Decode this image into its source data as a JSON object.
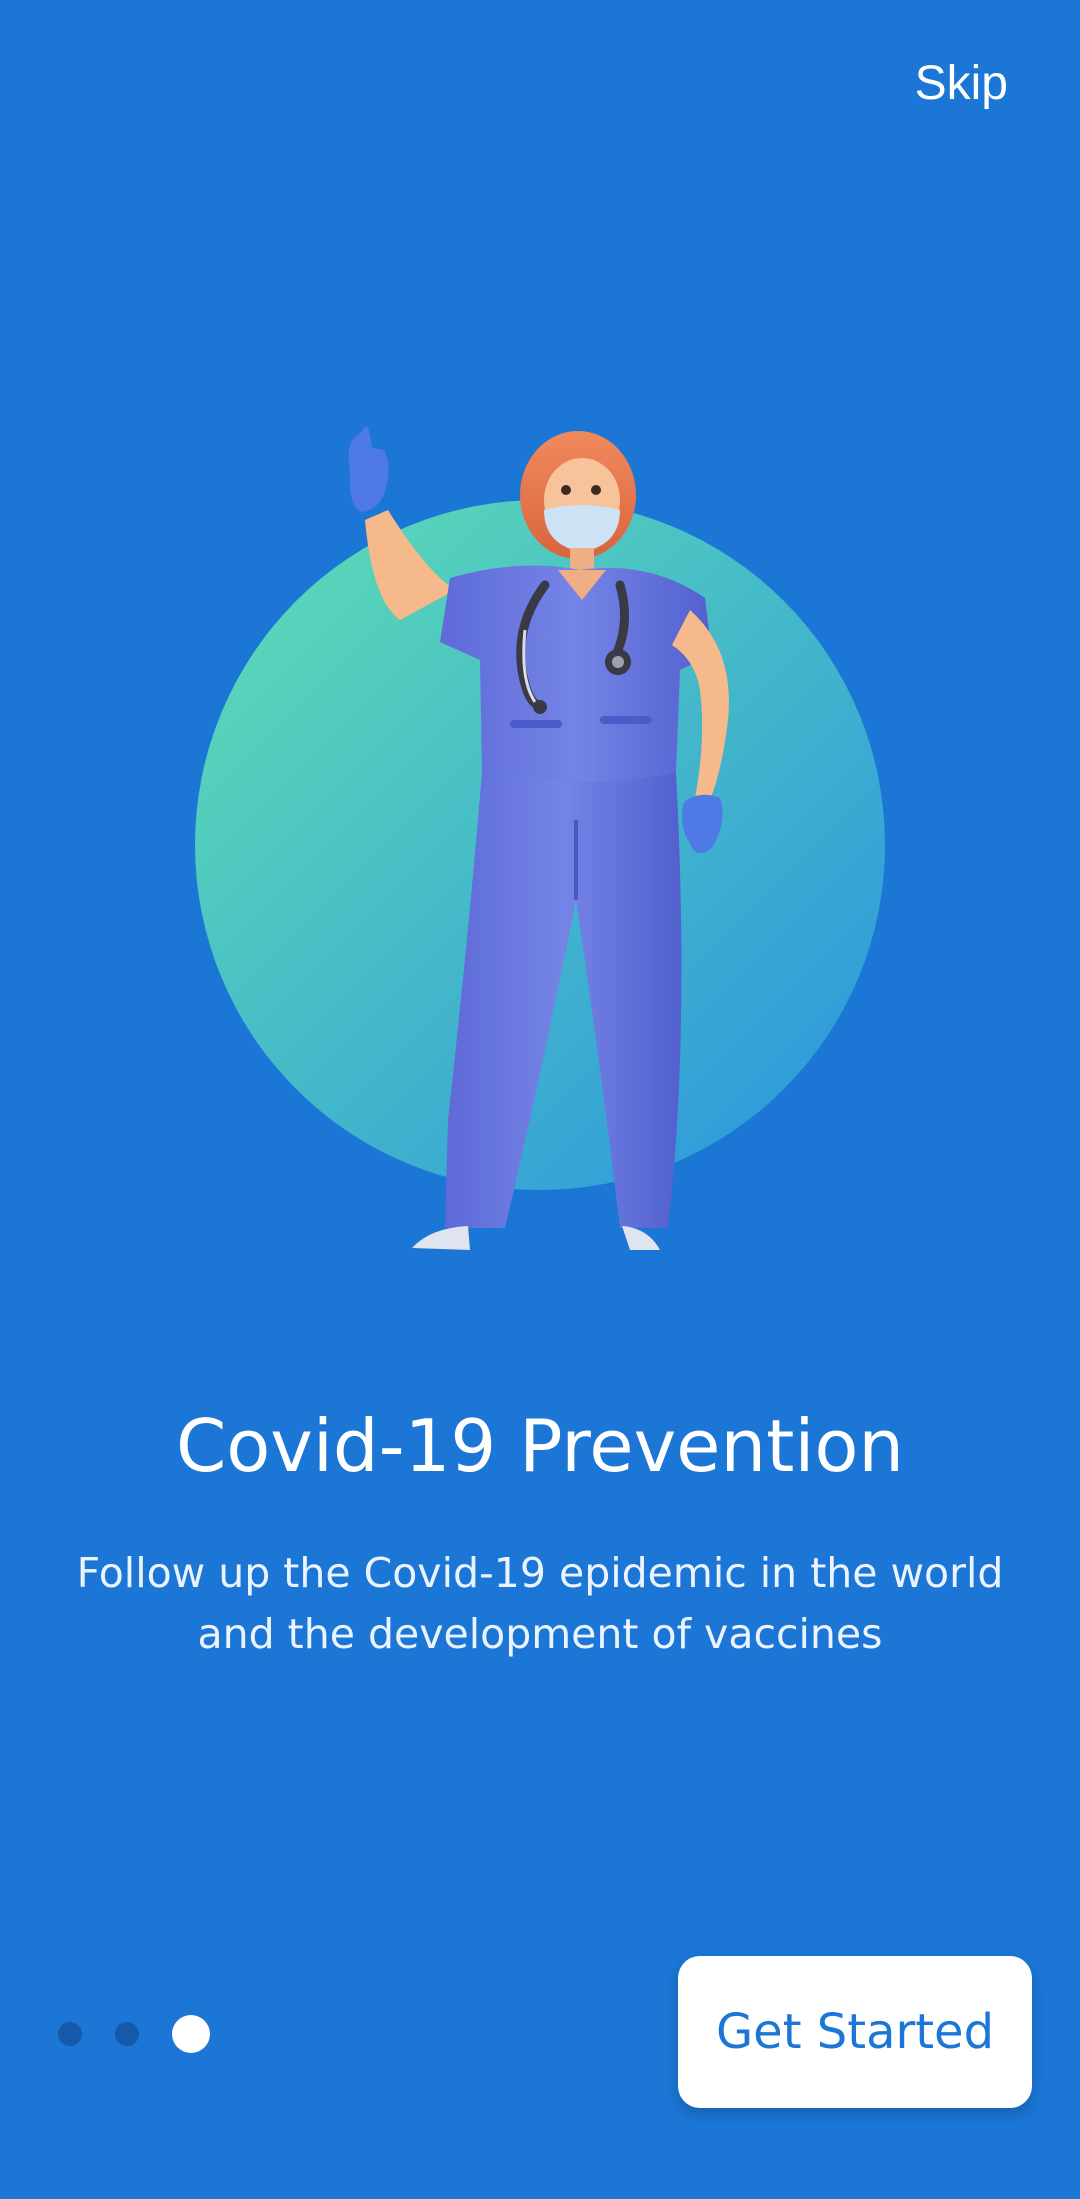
{
  "header": {
    "skip_label": "Skip"
  },
  "hero": {
    "illustration": "nurse-with-stethoscope-and-mask",
    "circle_gradient": [
      "#5fe0b2",
      "#2f9be0"
    ]
  },
  "content": {
    "title": "Covid-19 Prevention",
    "subtitle": "Follow up the Covid-19 epidemic in the world and the development of vaccines"
  },
  "pager": {
    "current_page": 3,
    "total_pages": 3
  },
  "footer": {
    "cta_label": "Get Started"
  },
  "colors": {
    "background": "#1b76d6",
    "dot_inactive": "#1559a8",
    "dot_active": "#ffffff",
    "cta_text": "#1b76d6"
  }
}
